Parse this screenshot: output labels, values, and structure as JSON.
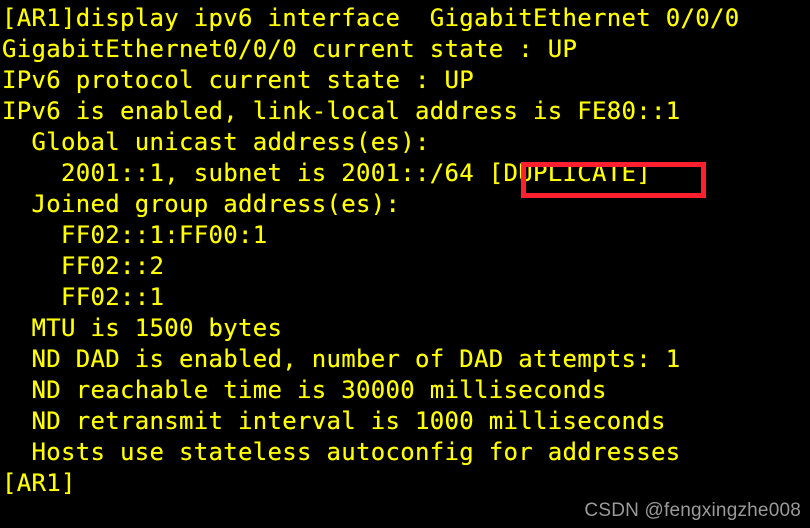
{
  "terminal": {
    "title": "eNSP Router Console",
    "background_color": "#000000",
    "text_color": "#ffff00",
    "prompt": "[AR1]",
    "command": "display ipv6 interface  GigabitEthernet 0/0/0",
    "lines": [
      "[AR1]display ipv6 interface  GigabitEthernet 0/0/0",
      "GigabitEthernet0/0/0 current state : UP",
      "IPv6 protocol current state : UP",
      "IPv6 is enabled, link-local address is FE80::1",
      "  Global unicast address(es):",
      "    2001::1, subnet is 2001::/64 [DUPLICATE]",
      "  Joined group address(es):",
      "    FF02::1:FF00:1",
      "    FF02::2",
      "    FF02::1",
      "  MTU is 1500 bytes",
      "  ND DAD is enabled, number of DAD attempts: 1",
      "  ND reachable time is 30000 milliseconds",
      "  ND retransmit interval is 1000 milliseconds",
      "  Hosts use stateless autoconfig for addresses",
      "[AR1]"
    ]
  },
  "interface_info": {
    "name": "GigabitEthernet0/0/0",
    "current_state": "UP",
    "ipv6_protocol_state": "UP",
    "ipv6_enabled": "enabled",
    "link_local_address": "FE80::1",
    "global_unicast_label": "Global unicast address(es):",
    "global_unicast_address": "2001::1",
    "global_unicast_subnet": "2001::/64",
    "duplicate_flag": "[DUPLICATE]",
    "joined_group_label": "Joined group address(es):",
    "joined_groups": [
      "FF02::1:FF00:1",
      "FF02::2",
      "FF02::1"
    ],
    "mtu": "1500 bytes",
    "nd_dad": "enabled",
    "nd_dad_attempts": "1",
    "nd_reachable_time": "30000 milliseconds",
    "nd_retransmit_interval": "1000 milliseconds",
    "host_autoconfig": "Hosts use stateless autoconfig for addresses"
  },
  "annotation": {
    "highlight_target": "[DUPLICATE]",
    "highlight_color": "#ff1f2e",
    "highlight_style": "rectangle-outline"
  },
  "watermark": {
    "text": "CSDN @fengxingzhe008",
    "color": "#9a9a9a"
  }
}
